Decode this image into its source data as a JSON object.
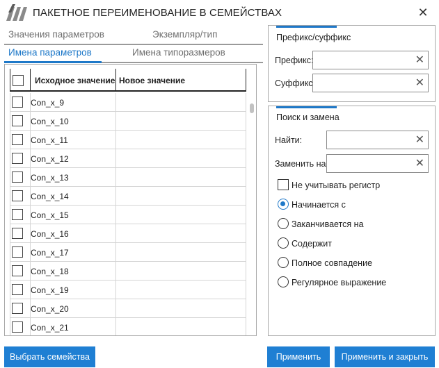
{
  "window": {
    "title": "ПАКЕТНОЕ ПЕРЕИМЕНОВАНИЕ В СЕМЕЙСТВАХ",
    "close_glyph": "✕"
  },
  "tabs": {
    "top_row": [
      "Значения параметров",
      "Экземпляр/тип"
    ],
    "bottom_row": [
      "Имена параметров",
      "Имена типоразмеров"
    ],
    "active": "Имена параметров"
  },
  "grid": {
    "columns": [
      "Исходное значение",
      "Новое значение"
    ],
    "rows": [
      {
        "source": "Con_x_9",
        "new": ""
      },
      {
        "source": "Con_x_10",
        "new": ""
      },
      {
        "source": "Con_x_11",
        "new": ""
      },
      {
        "source": "Con_x_12",
        "new": ""
      },
      {
        "source": "Con_x_13",
        "new": ""
      },
      {
        "source": "Con_x_14",
        "new": ""
      },
      {
        "source": "Con_x_15",
        "new": ""
      },
      {
        "source": "Con_x_16",
        "new": ""
      },
      {
        "source": "Con_x_17",
        "new": ""
      },
      {
        "source": "Con_x_18",
        "new": ""
      },
      {
        "source": "Con_x_19",
        "new": ""
      },
      {
        "source": "Con_x_20",
        "new": ""
      },
      {
        "source": "Con_x_21",
        "new": ""
      }
    ]
  },
  "prefix_suffix": {
    "title": "Префикс/суффикс",
    "prefix_label": "Префикс:",
    "prefix_value": "",
    "suffix_label": "Суффикс:",
    "suffix_value": "",
    "clear_glyph": "✕"
  },
  "find_replace": {
    "title": "Поиск и замена",
    "find_label": "Найти:",
    "find_value": "",
    "replace_label": "Заменить на:",
    "replace_value": "",
    "ignore_case_label": "Не учитывать регистр",
    "ignore_case_checked": false,
    "modes": [
      "Начинается с",
      "Заканчивается на",
      "Содержит",
      "Полное совпадение",
      "Регулярное выражение"
    ],
    "selected_mode": "Начинается с"
  },
  "buttons": {
    "select_families": "Выбрать семейства",
    "apply": "Применить",
    "apply_close": "Применить и закрыть"
  },
  "colors": {
    "accent": "#1e78c8",
    "button": "#1f7fd3"
  }
}
